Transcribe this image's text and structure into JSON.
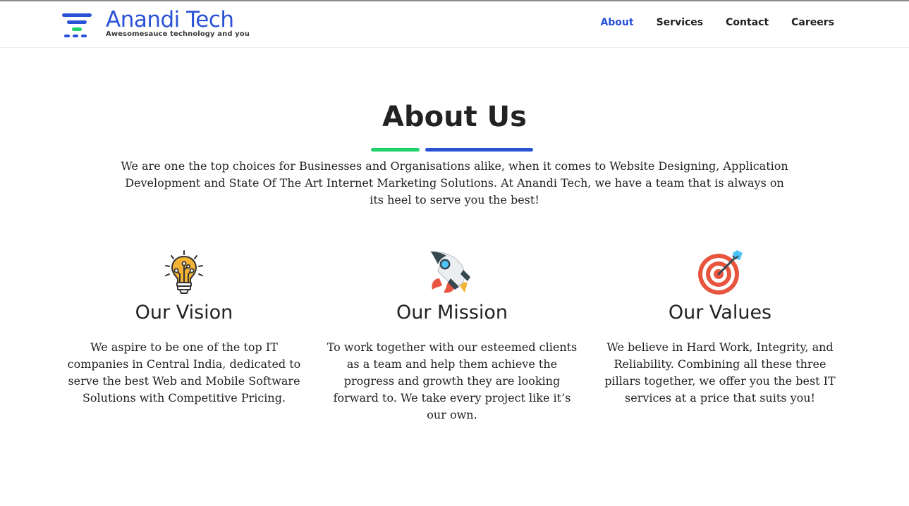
{
  "brand": {
    "name": "Anandi Tech",
    "tagline": "Awesomesauce technology and you",
    "primary_color": "#2a52d7",
    "accent_color": "#1ed36a"
  },
  "nav": {
    "items": [
      {
        "label": "About",
        "active": true
      },
      {
        "label": "Services",
        "active": false
      },
      {
        "label": "Contact",
        "active": false
      },
      {
        "label": "Careers",
        "active": false
      }
    ]
  },
  "about": {
    "title": "About Us",
    "intro": "We are one the top choices for Businesses and Organisations alike, when it comes to Website Designing, Application Development and State Of The Art Internet Marketing Solutions. At Anandi Tech, we have a team that is always on its heel to serve you the best!"
  },
  "cards": [
    {
      "icon": "lightbulb-icon",
      "title": "Our Vision",
      "text": "We aspire to be one of the top IT companies in Central India, dedicated to serve the best Web and Mobile Software Solutions with Competitive Pricing."
    },
    {
      "icon": "rocket-icon",
      "title": "Our Mission",
      "text": "To work together with our esteemed clients as a team and help them achieve the progress and growth they are looking forward to. We take every project like it’s our own."
    },
    {
      "icon": "target-icon",
      "title": "Our Values",
      "text": "We believe in Hard Work, Integrity, and Reliability. Combining all these three pillars together, we offer you the best IT services at a price that suits you!"
    }
  ]
}
